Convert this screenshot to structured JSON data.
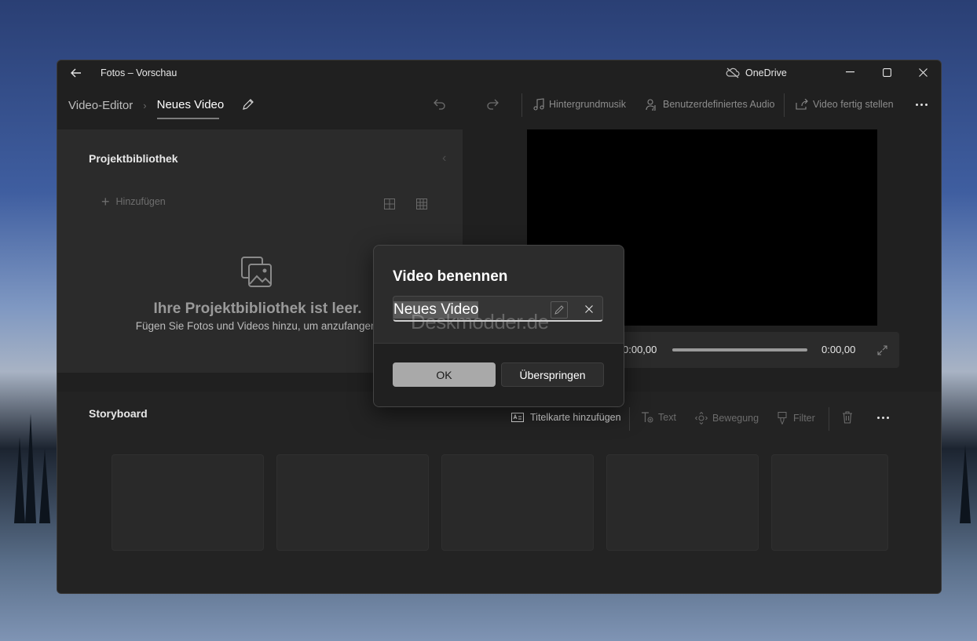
{
  "window": {
    "title": "Fotos – Vorschau",
    "onedrive_label": "OneDrive"
  },
  "breadcrumb": {
    "root": "Video-Editor",
    "current": "Neues Video"
  },
  "toolbar": {
    "background_music": "Hintergrundmusik",
    "custom_audio": "Benutzerdefiniertes Audio",
    "finish_video": "Video fertig stellen"
  },
  "library": {
    "title": "Projektbibliothek",
    "add_label": "Hinzufügen",
    "empty_title": "Ihre Projektbibliothek ist leer.",
    "empty_subtitle": "Fügen Sie Fotos und Videos hinzu, um anzufangen."
  },
  "player": {
    "current_time": "0:00,00",
    "total_time": "0:00,00",
    "progress": 0
  },
  "storyboard": {
    "title": "Storyboard",
    "title_card": "Titelkarte hinzufügen",
    "text": "Text",
    "motion": "Bewegung",
    "filter": "Filter",
    "card_count": 5
  },
  "dialog": {
    "title": "Video benennen",
    "input_value": "Neues Video",
    "ok_label": "OK",
    "skip_label": "Überspringen"
  },
  "watermark": "Deskmodder.de",
  "colors": {
    "accent_underline": "#cfcfcf",
    "ok_button": "#a9a9a9"
  }
}
